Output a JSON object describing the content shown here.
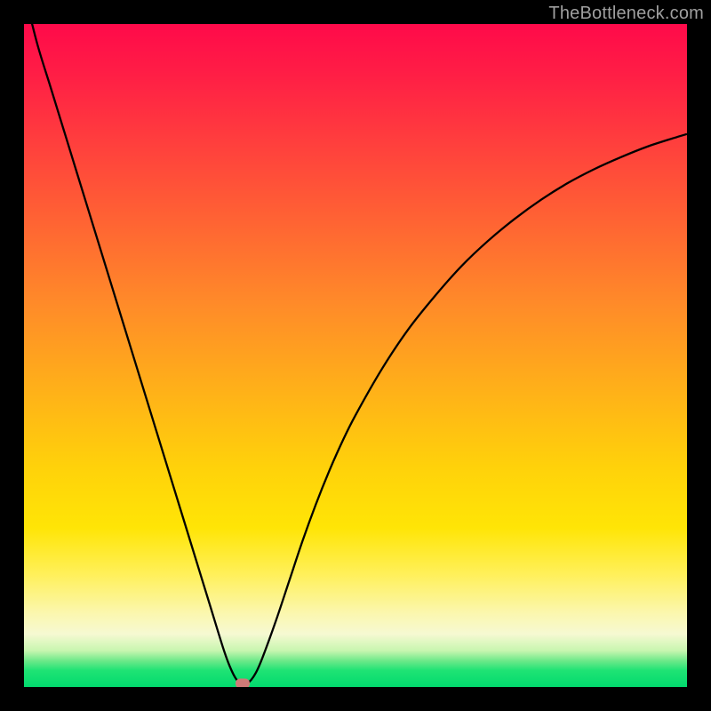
{
  "watermark": "TheBottleneck.com",
  "chart_data": {
    "type": "line",
    "title": "",
    "xlabel": "",
    "ylabel": "",
    "xlim": [
      0,
      100
    ],
    "ylim": [
      0,
      100
    ],
    "grid": false,
    "series": [
      {
        "name": "bottleneck-curve",
        "x": [
          0,
          2,
          4,
          6,
          8,
          10,
          12,
          14,
          16,
          18,
          20,
          22,
          24,
          26,
          28,
          30,
          31,
          32,
          33,
          34,
          35,
          36,
          38,
          40,
          42,
          44,
          46,
          48,
          50,
          54,
          58,
          62,
          66,
          70,
          74,
          78,
          82,
          86,
          90,
          94,
          98,
          100
        ],
        "y": [
          105,
          97,
          90.5,
          84,
          77.5,
          71,
          64.5,
          58,
          51.5,
          45,
          38.5,
          32,
          25.5,
          19,
          12.5,
          6,
          3.2,
          1.2,
          0.4,
          0.8,
          2.2,
          4.5,
          10,
          16,
          22,
          27.5,
          32.5,
          37,
          41,
          48,
          54,
          59,
          63.5,
          67.3,
          70.6,
          73.5,
          76,
          78.1,
          79.9,
          81.5,
          82.8,
          83.4
        ]
      }
    ],
    "marker": {
      "x": 33,
      "y": 0.5,
      "color": "#cf7a77"
    },
    "gradient_stops": [
      {
        "pct": 0,
        "color": "#ff0a4a"
      },
      {
        "pct": 18,
        "color": "#ff3f3d"
      },
      {
        "pct": 42,
        "color": "#ff8a29"
      },
      {
        "pct": 67,
        "color": "#ffd20a"
      },
      {
        "pct": 89,
        "color": "#fbf7b0"
      },
      {
        "pct": 96,
        "color": "#6fe98a"
      },
      {
        "pct": 100,
        "color": "#02da6e"
      }
    ]
  },
  "marker_color": "#cf7a77"
}
